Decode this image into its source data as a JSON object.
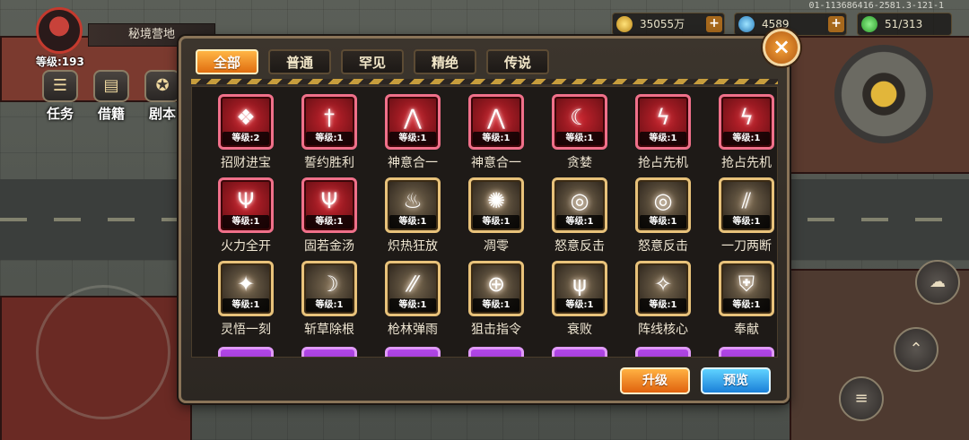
{
  "hud": {
    "zone_name": "秘境营地",
    "player_level": "等级:193",
    "gold": "35055万",
    "gems": "4589",
    "energy": "51/313",
    "server_id": "01-113686416-2581.3-121-1",
    "plus": "+"
  },
  "left_buttons": [
    "任务",
    "借籍",
    "剧本"
  ],
  "dialog": {
    "close": "×",
    "tabs": [
      {
        "label": "全部",
        "active": true
      },
      {
        "label": "普通",
        "active": false
      },
      {
        "label": "罕见",
        "active": false
      },
      {
        "label": "精绝",
        "active": false
      },
      {
        "label": "传说",
        "active": false
      }
    ],
    "skills": [
      {
        "name": "招财进宝",
        "level": "等级:2",
        "rarity": "red",
        "icon": "fan-icon",
        "glyph": "❖"
      },
      {
        "name": "誓约胜利",
        "level": "等级:1",
        "rarity": "red",
        "icon": "sword-icon",
        "glyph": "†"
      },
      {
        "name": "神意合一",
        "level": "等级:1",
        "rarity": "red",
        "icon": "wings-icon",
        "glyph": "⋀"
      },
      {
        "name": "神意合一",
        "level": "等级:1",
        "rarity": "red",
        "icon": "wings-icon",
        "glyph": "⋀"
      },
      {
        "name": "贪婪",
        "level": "等级:1",
        "rarity": "red",
        "icon": "claw-icon",
        "glyph": "☾"
      },
      {
        "name": "抢占先机",
        "level": "等级:1",
        "rarity": "red",
        "icon": "lightning-icon",
        "glyph": "ϟ"
      },
      {
        "name": "抢占先机",
        "level": "等级:1",
        "rarity": "red",
        "icon": "lightning-icon",
        "glyph": "ϟ"
      },
      {
        "name": "火力全开",
        "level": "等级:1",
        "rarity": "red",
        "icon": "trident-icon",
        "glyph": "Ψ"
      },
      {
        "name": "固若金汤",
        "level": "等级:1",
        "rarity": "red",
        "icon": "shield-icon",
        "glyph": "Ψ"
      },
      {
        "name": "炽热狂放",
        "level": "等级:1",
        "rarity": "gold",
        "icon": "flame-icon",
        "glyph": "♨"
      },
      {
        "name": "凋零",
        "level": "等级:1",
        "rarity": "gold",
        "icon": "wither-icon",
        "glyph": "✺"
      },
      {
        "name": "怒意反击",
        "level": "等级:1",
        "rarity": "gold",
        "icon": "swirl-icon",
        "glyph": "◎"
      },
      {
        "name": "怒意反击",
        "level": "等级:1",
        "rarity": "gold",
        "icon": "swirl-icon",
        "glyph": "◎"
      },
      {
        "name": "一刀两断",
        "level": "等级:1",
        "rarity": "gold",
        "icon": "slash-icon",
        "glyph": "⫽"
      },
      {
        "name": "灵悟一刻",
        "level": "等级:1",
        "rarity": "gold",
        "icon": "spark-icon",
        "glyph": "✦"
      },
      {
        "name": "斩草除根",
        "level": "等级:1",
        "rarity": "gold",
        "icon": "scythe-icon",
        "glyph": "☽"
      },
      {
        "name": "枪林弹雨",
        "level": "等级:1",
        "rarity": "gold",
        "icon": "bullets-icon",
        "glyph": "⁄⁄"
      },
      {
        "name": "狙击指令",
        "level": "等级:1",
        "rarity": "gold",
        "icon": "crosshair-icon",
        "glyph": "⊕"
      },
      {
        "name": "衰败",
        "level": "等级:1",
        "rarity": "gold",
        "icon": "tree-icon",
        "glyph": "ψ"
      },
      {
        "name": "阵线核心",
        "level": "等级:1",
        "rarity": "gold",
        "icon": "core-icon",
        "glyph": "✧"
      },
      {
        "name": "奉献",
        "level": "等级:1",
        "rarity": "gold",
        "icon": "shield-cross-icon",
        "glyph": "⛨"
      }
    ],
    "upgrade_label": "升级",
    "preview_label": "预览"
  }
}
